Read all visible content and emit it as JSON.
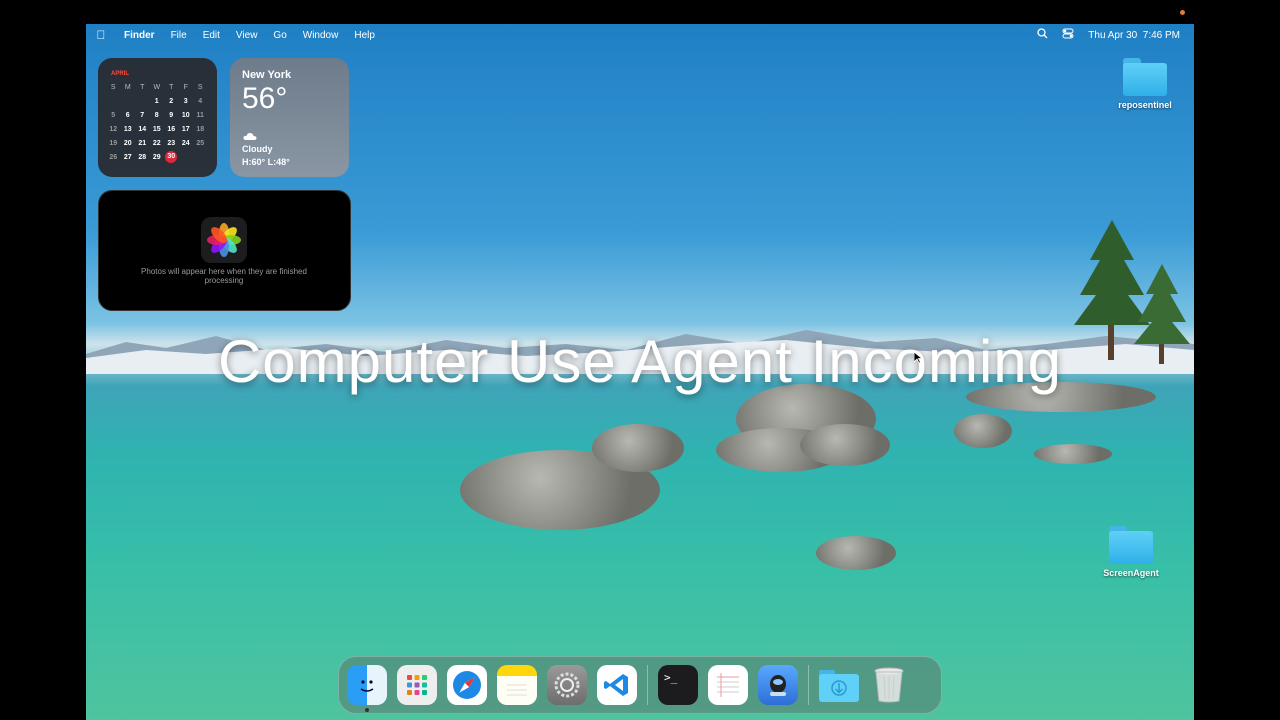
{
  "menubar": {
    "apple_icon": "apple-icon",
    "app_name": "Finder",
    "menus": [
      "File",
      "Edit",
      "View",
      "Go",
      "Window",
      "Help"
    ],
    "clock": "Thu Apr 30  7:46 PM"
  },
  "calendar": {
    "month": "APRIL",
    "weekdays": [
      "S",
      "M",
      "T",
      "W",
      "T",
      "F",
      "S"
    ],
    "weeks": [
      [
        "",
        "",
        "",
        "1",
        "2",
        "3",
        "4"
      ],
      [
        "5",
        "6",
        "7",
        "8",
        "9",
        "10",
        "11"
      ],
      [
        "12",
        "13",
        "14",
        "15",
        "16",
        "17",
        "18"
      ],
      [
        "19",
        "20",
        "21",
        "22",
        "23",
        "24",
        "25"
      ],
      [
        "26",
        "27",
        "28",
        "29",
        "30",
        "",
        ""
      ]
    ],
    "today": "30"
  },
  "weather": {
    "city": "New York",
    "temp": "56°",
    "condition": "Cloudy",
    "hilo": "H:60° L:48°"
  },
  "photos": {
    "message": "Photos will appear here when they are finished processing"
  },
  "desktop_icons": [
    {
      "label": "reposentinel"
    },
    {
      "label": "ScreenAgent"
    }
  ],
  "overlay_text": "Computer Use Agent Incoming",
  "dock": {
    "apps": [
      "finder-icon",
      "launchpad-icon",
      "safari-icon",
      "notes-icon",
      "system-settings-icon",
      "vscode-icon",
      "terminal-icon",
      "textedit-icon",
      "screen-agent-icon",
      "downloads-folder-icon",
      "trash-icon"
    ]
  }
}
